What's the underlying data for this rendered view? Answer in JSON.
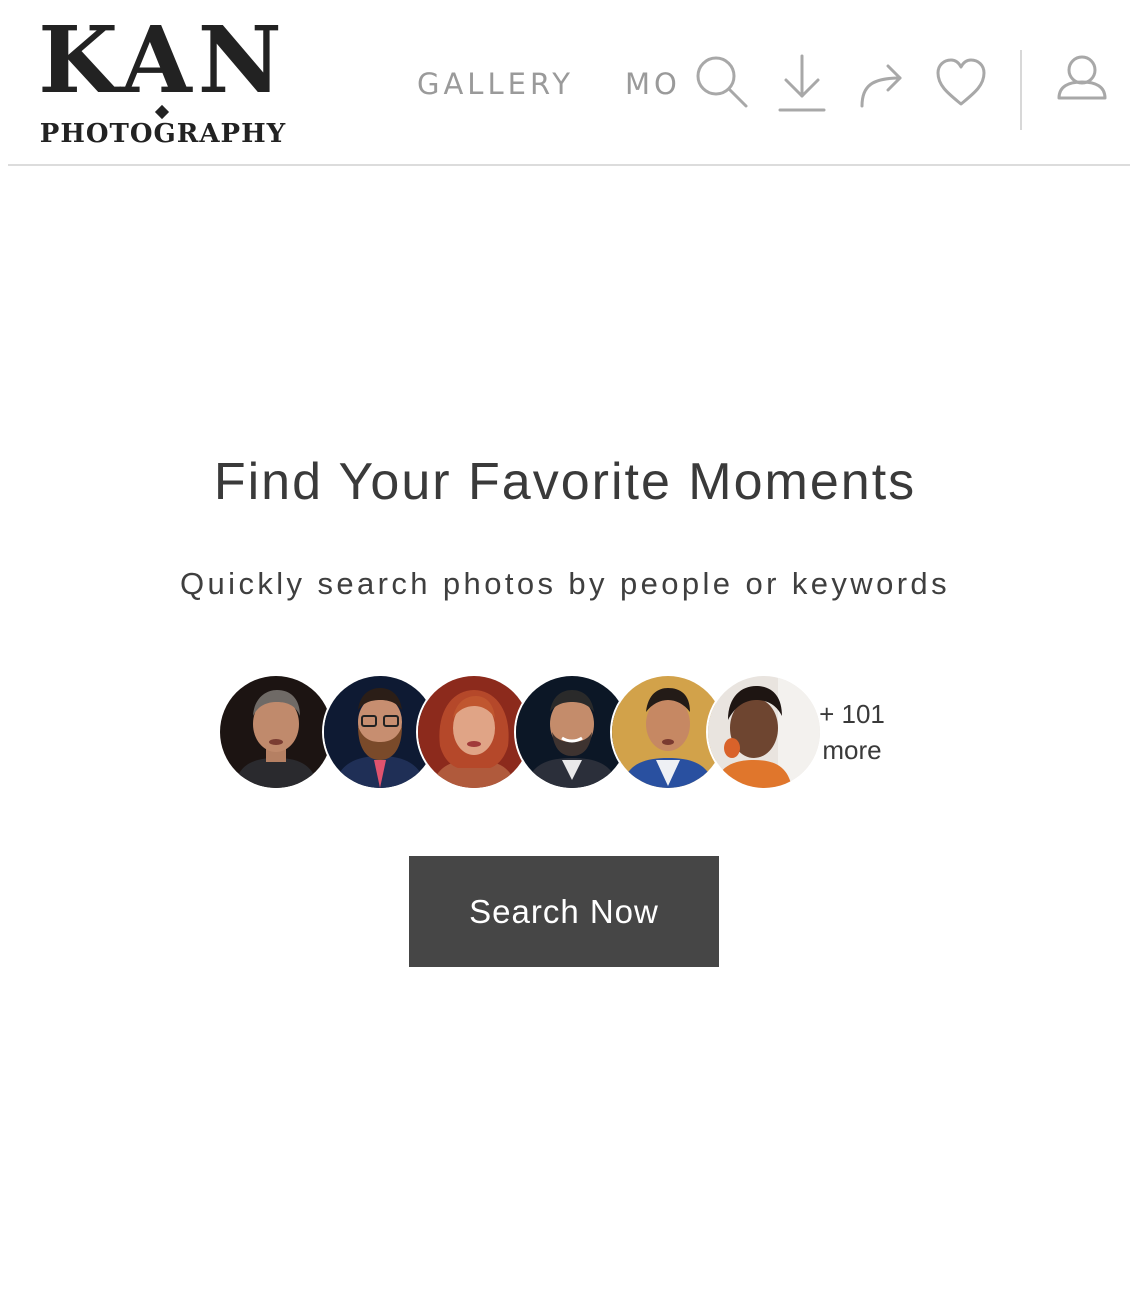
{
  "brand": {
    "name": "KAN",
    "tagline": "PHOTOGRAPHY"
  },
  "nav": {
    "links": [
      {
        "label": "GALLERY"
      },
      {
        "label": "MORE"
      }
    ],
    "icons": [
      "search-icon",
      "download-icon",
      "share-icon",
      "heart-icon",
      "user-icon"
    ]
  },
  "hero": {
    "title": "Find Your Favorite Moments",
    "subtitle": "Quickly search photos by people or keywords"
  },
  "people": {
    "more_count": "+ 101",
    "more_label": "more"
  },
  "cta": {
    "label": "Search Now"
  },
  "colors": {
    "background": "#ffffff",
    "text": "#333333",
    "nav_gray": "#9a9a9a",
    "button_bg": "#464646",
    "button_text": "#ffffff"
  }
}
